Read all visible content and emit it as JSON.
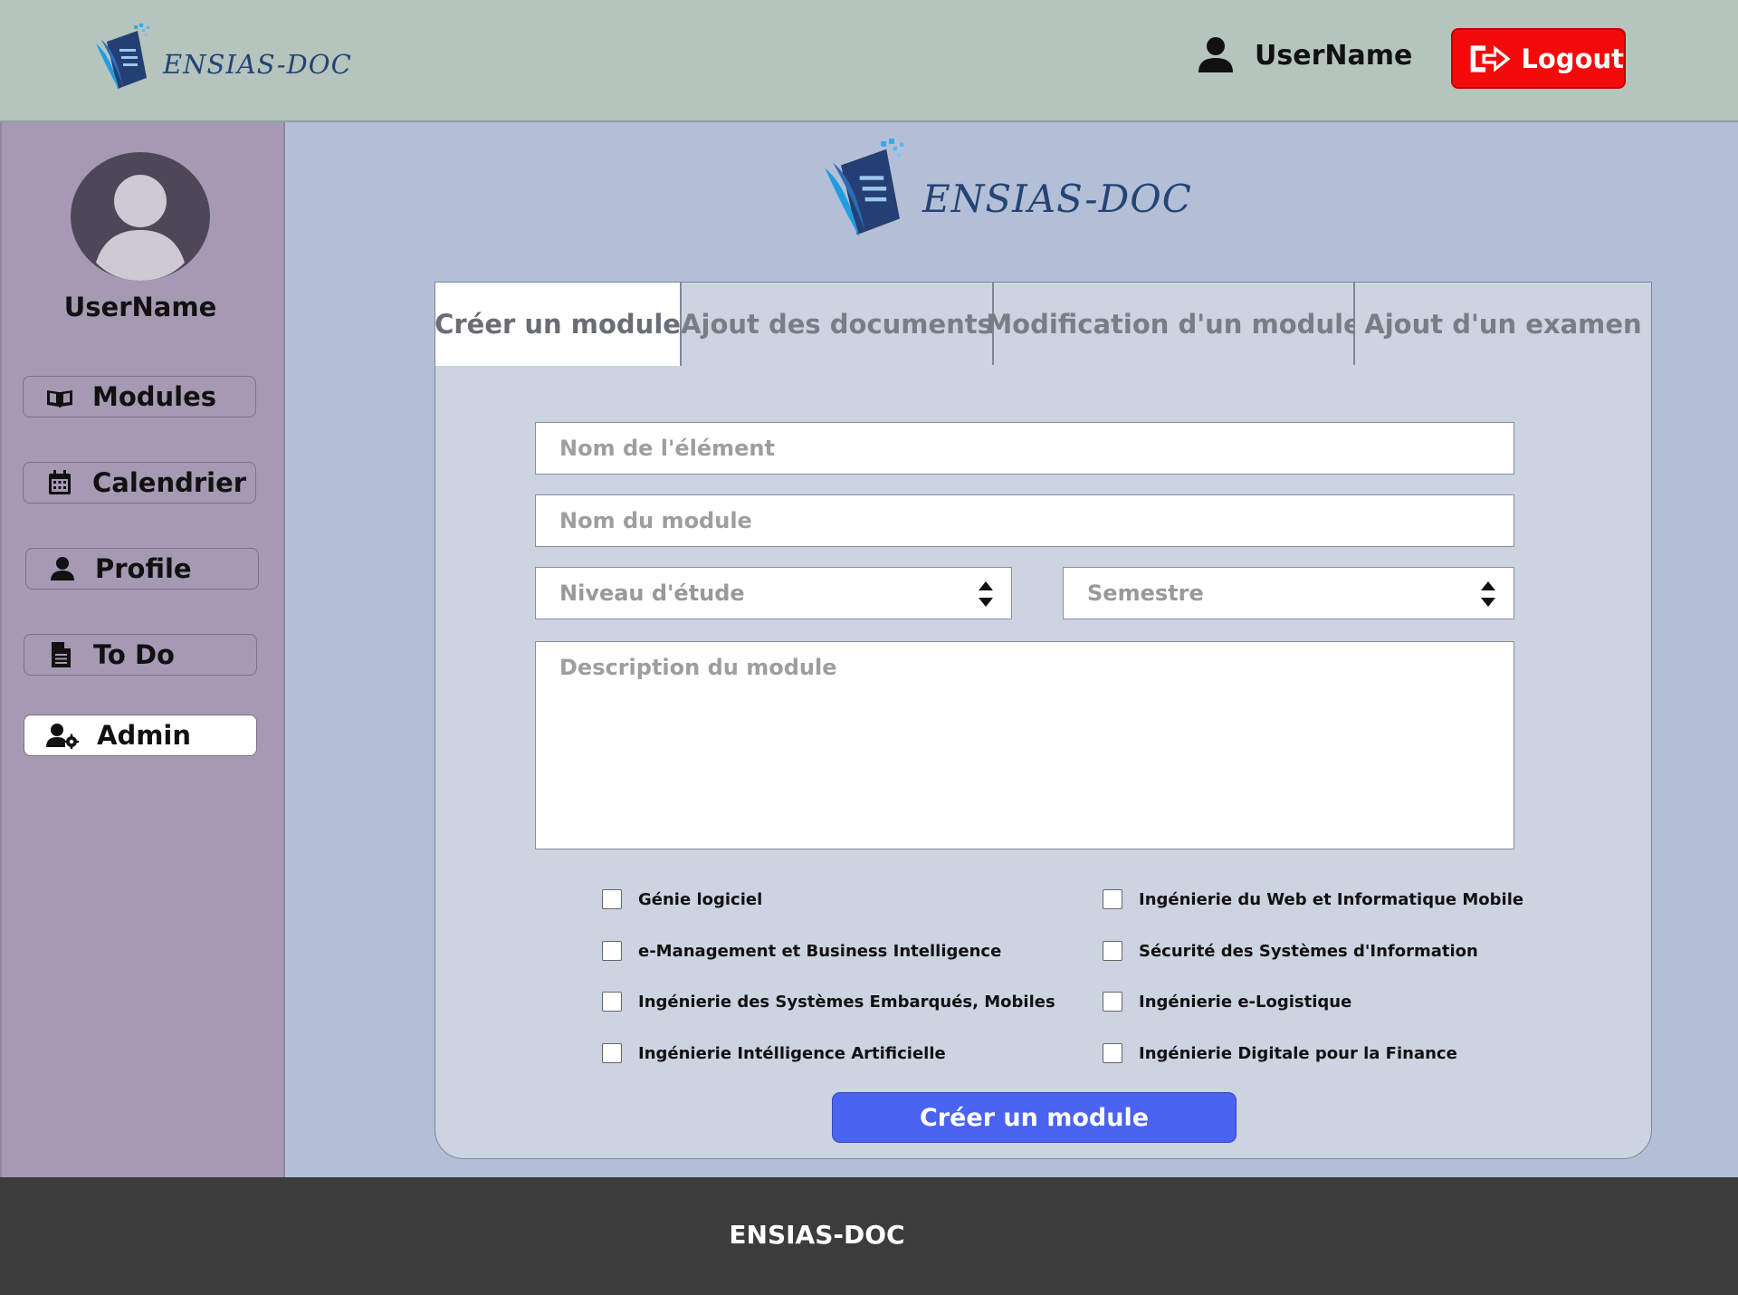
{
  "brand": {
    "name": "ENSIAS-DOC",
    "colors": {
      "header_bg": "#b5c4bc",
      "sidebar_bg": "#a699b3",
      "main_bg": "#b3bfd6",
      "logout": "#f40a0a",
      "primary": "#4a63f0",
      "footer_bg": "#3c3c3c",
      "logo_text": "#234476"
    }
  },
  "header": {
    "username": "UserName",
    "user_icon": "user-icon",
    "logout_label": "Logout",
    "logout_icon": "sign-out-icon"
  },
  "sidebar": {
    "username": "UserName",
    "items": [
      {
        "label": "Modules",
        "icon": "book-open-icon",
        "active": false
      },
      {
        "label": "Calendrier",
        "icon": "calendar-icon",
        "active": false
      },
      {
        "label": "Profile",
        "icon": "user-icon",
        "active": false
      },
      {
        "label": "To Do",
        "icon": "file-text-icon",
        "active": false
      },
      {
        "label": "Admin",
        "icon": "user-cog-icon",
        "active": true
      }
    ]
  },
  "tabs": [
    {
      "label": "Créer un module",
      "active": true
    },
    {
      "label": "Ajout des documents",
      "active": false
    },
    {
      "label": "Modification d'un module",
      "active": false
    },
    {
      "label": "Ajout d'un examen",
      "active": false
    }
  ],
  "form": {
    "element_name_placeholder": "Nom de l'élément",
    "module_name_placeholder": "Nom du module",
    "level_placeholder": "Niveau d'étude",
    "semester_placeholder": "Semestre",
    "description_placeholder": "Description du module",
    "filieres": [
      {
        "label": "Génie logiciel",
        "checked": false
      },
      {
        "label": "Ingénierie du Web et Informatique Mobile",
        "checked": false
      },
      {
        "label": "e-Management et Business Intelligence",
        "checked": false
      },
      {
        "label": "Sécurité des Systèmes d'Information",
        "checked": false
      },
      {
        "label": "Ingénierie des Systèmes Embarqués, Mobiles",
        "checked": false
      },
      {
        "label": "Ingénierie e-Logistique",
        "checked": false
      },
      {
        "label": "Ingénierie Intélligence Artificielle",
        "checked": false
      },
      {
        "label": "Ingénierie Digitale pour la Finance",
        "checked": false
      }
    ],
    "submit_label": "Créer un module"
  },
  "footer": {
    "text": "ENSIAS-DOC"
  }
}
